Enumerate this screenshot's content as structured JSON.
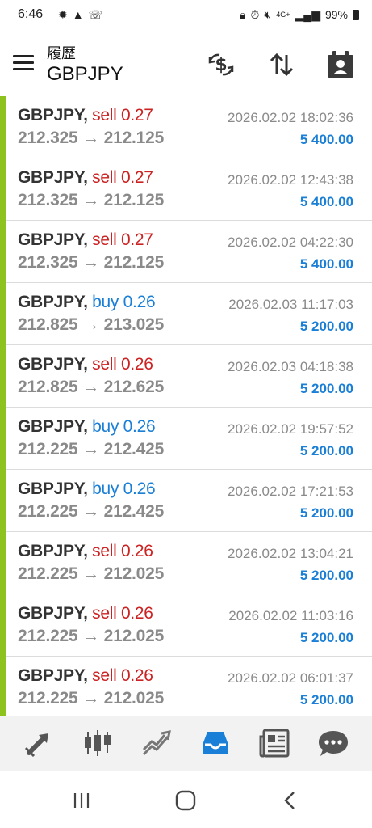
{
  "status_bar": {
    "time": "6:46",
    "battery": "99%",
    "network": "4G+"
  },
  "header": {
    "title_small": "履歴",
    "title_main": "GBPJPY"
  },
  "trades": [
    {
      "symbol": "GBPJPY,",
      "side": "sell",
      "volume": "0.27",
      "open": "212.325",
      "close": "212.125",
      "datetime": "2026.02.02 18:02:36",
      "profit": "5 400.00"
    },
    {
      "symbol": "GBPJPY,",
      "side": "sell",
      "volume": "0.27",
      "open": "212.325",
      "close": "212.125",
      "datetime": "2026.02.02 12:43:38",
      "profit": "5 400.00"
    },
    {
      "symbol": "GBPJPY,",
      "side": "sell",
      "volume": "0.27",
      "open": "212.325",
      "close": "212.125",
      "datetime": "2026.02.02 04:22:30",
      "profit": "5 400.00"
    },
    {
      "symbol": "GBPJPY,",
      "side": "buy",
      "volume": "0.26",
      "open": "212.825",
      "close": "213.025",
      "datetime": "2026.02.03 11:17:03",
      "profit": "5 200.00"
    },
    {
      "symbol": "GBPJPY,",
      "side": "sell",
      "volume": "0.26",
      "open": "212.825",
      "close": "212.625",
      "datetime": "2026.02.03 04:18:38",
      "profit": "5 200.00"
    },
    {
      "symbol": "GBPJPY,",
      "side": "buy",
      "volume": "0.26",
      "open": "212.225",
      "close": "212.425",
      "datetime": "2026.02.02 19:57:52",
      "profit": "5 200.00"
    },
    {
      "symbol": "GBPJPY,",
      "side": "buy",
      "volume": "0.26",
      "open": "212.225",
      "close": "212.425",
      "datetime": "2026.02.02 17:21:53",
      "profit": "5 200.00"
    },
    {
      "symbol": "GBPJPY,",
      "side": "sell",
      "volume": "0.26",
      "open": "212.225",
      "close": "212.025",
      "datetime": "2026.02.02 13:04:21",
      "profit": "5 200.00"
    },
    {
      "symbol": "GBPJPY,",
      "side": "sell",
      "volume": "0.26",
      "open": "212.225",
      "close": "212.025",
      "datetime": "2026.02.02 11:03:16",
      "profit": "5 200.00"
    },
    {
      "symbol": "GBPJPY,",
      "side": "sell",
      "volume": "0.26",
      "open": "212.225",
      "close": "212.025",
      "datetime": "2026.02.02 06:01:37",
      "profit": "5 200.00"
    }
  ],
  "arrow": "→",
  "colors": {
    "accent_bar": "#8dc21f",
    "sell": "#cc2222",
    "buy": "#1a7fd6",
    "profit": "#1a7fd6",
    "active_nav": "#1a7fd6"
  },
  "bottom_nav": [
    {
      "icon": "trade-arrows-icon",
      "active": false
    },
    {
      "icon": "candlestick-chart-icon",
      "active": false
    },
    {
      "icon": "trend-line-icon",
      "active": false
    },
    {
      "icon": "history-inbox-icon",
      "active": true
    },
    {
      "icon": "news-icon",
      "active": false
    },
    {
      "icon": "chat-icon",
      "active": false
    }
  ]
}
